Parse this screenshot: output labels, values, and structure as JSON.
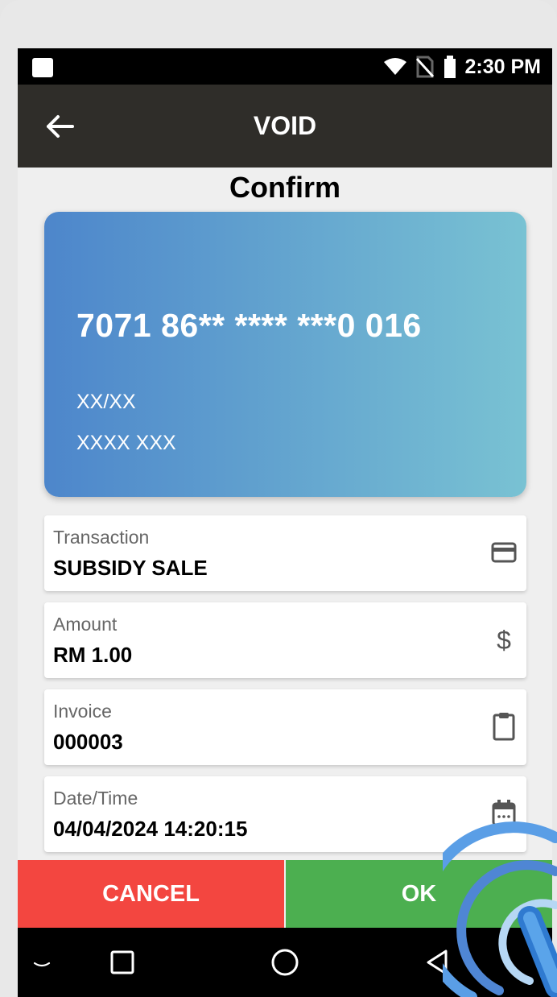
{
  "status_bar": {
    "time": "2:30 PM",
    "icons": [
      "notification-square-icon",
      "wifi-icon",
      "no-sim-icon",
      "battery-icon"
    ]
  },
  "top_bar": {
    "title": "VOID",
    "back_icon": "back-arrow-icon"
  },
  "confirm_title": "Confirm",
  "card": {
    "number": "7071 86** **** ***0 016",
    "expiry": "XX/XX",
    "name": "XXXX XXX",
    "gradient": [
      "#4d86cb",
      "#79c2d3"
    ]
  },
  "fields": [
    {
      "label": "Transaction",
      "value": "SUBSIDY SALE",
      "icon": "credit-card-icon"
    },
    {
      "label": "Amount",
      "value": "RM 1.00",
      "icon": "dollar-icon"
    },
    {
      "label": "Invoice",
      "value": "000003",
      "icon": "clipboard-icon"
    },
    {
      "label": "Date/Time",
      "value": "04/04/2024 14:20:15",
      "icon": "calendar-icon"
    }
  ],
  "actions": {
    "cancel": "CANCEL",
    "ok": "OK",
    "cancel_color": "#f34640",
    "ok_color": "#4caf50"
  },
  "nav_bar": {
    "icons": [
      "keyboard-dismiss-icon",
      "recent-apps-icon",
      "home-icon",
      "back-icon"
    ]
  },
  "overlay": {
    "icon": "tap-contactless-icon"
  }
}
